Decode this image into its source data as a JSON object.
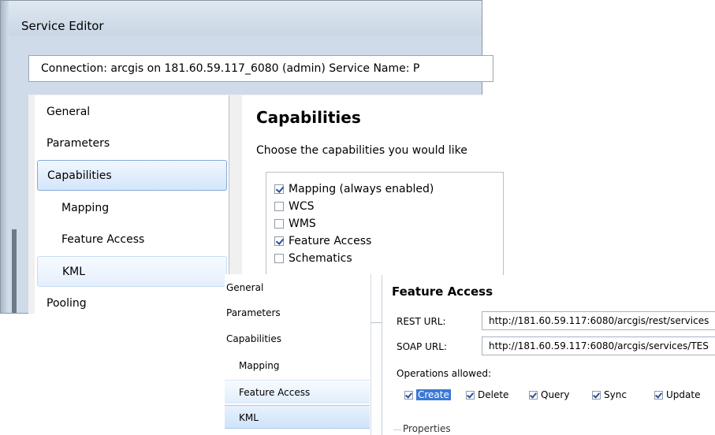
{
  "window": {
    "title": "Service Editor",
    "connection_text": "Connection: arcgis on 181.60.59.117_6080 (admin)   Service Name: P"
  },
  "nav_main": {
    "items": [
      {
        "label": "General",
        "state": "normal",
        "indent": false
      },
      {
        "label": "Parameters",
        "state": "normal",
        "indent": false
      },
      {
        "label": "Capabilities",
        "state": "selected",
        "indent": false
      },
      {
        "label": "Mapping",
        "state": "normal",
        "indent": true
      },
      {
        "label": "Feature Access",
        "state": "normal",
        "indent": true
      },
      {
        "label": "KML",
        "state": "hover",
        "indent": true
      },
      {
        "label": "Pooling",
        "state": "normal",
        "indent": false
      }
    ]
  },
  "capabilities": {
    "title": "Capabilities",
    "description": "Choose the capabilities you would like",
    "items": [
      {
        "label": "Mapping (always enabled)",
        "checked": true
      },
      {
        "label": "WCS",
        "checked": false
      },
      {
        "label": "WMS",
        "checked": false
      },
      {
        "label": "Feature Access",
        "checked": true
      },
      {
        "label": "Schematics",
        "checked": false
      }
    ]
  },
  "nav_second": {
    "items": [
      {
        "label": "General",
        "state": "normal",
        "indent": false
      },
      {
        "label": "Parameters",
        "state": "normal",
        "indent": false
      },
      {
        "label": "Capabilities",
        "state": "normal",
        "indent": false
      },
      {
        "label": "Mapping",
        "state": "normal",
        "indent": true
      },
      {
        "label": "Feature Access",
        "state": "hover",
        "indent": true
      },
      {
        "label": "KML",
        "state": "selected",
        "indent": true
      }
    ]
  },
  "feature_access": {
    "title": "Feature Access",
    "rest_label": "REST URL:",
    "rest_value": "http://181.60.59.117:6080/arcgis/rest/services",
    "soap_label": "SOAP URL:",
    "soap_value": "http://181.60.59.117:6080/arcgis/services/TES",
    "operations_label": "Operations allowed:",
    "operations": [
      {
        "label": "Create",
        "checked": true,
        "highlighted": true
      },
      {
        "label": "Delete",
        "checked": true,
        "highlighted": false
      },
      {
        "label": "Query",
        "checked": true,
        "highlighted": false
      },
      {
        "label": "Sync",
        "checked": true,
        "highlighted": false
      },
      {
        "label": "Update",
        "checked": true,
        "highlighted": false
      }
    ],
    "properties_label": "Properties"
  },
  "colors": {
    "selection_blue": "#3b78d6",
    "nav_selected_border": "#84aad8",
    "window_frame": "#cfdbe8"
  }
}
